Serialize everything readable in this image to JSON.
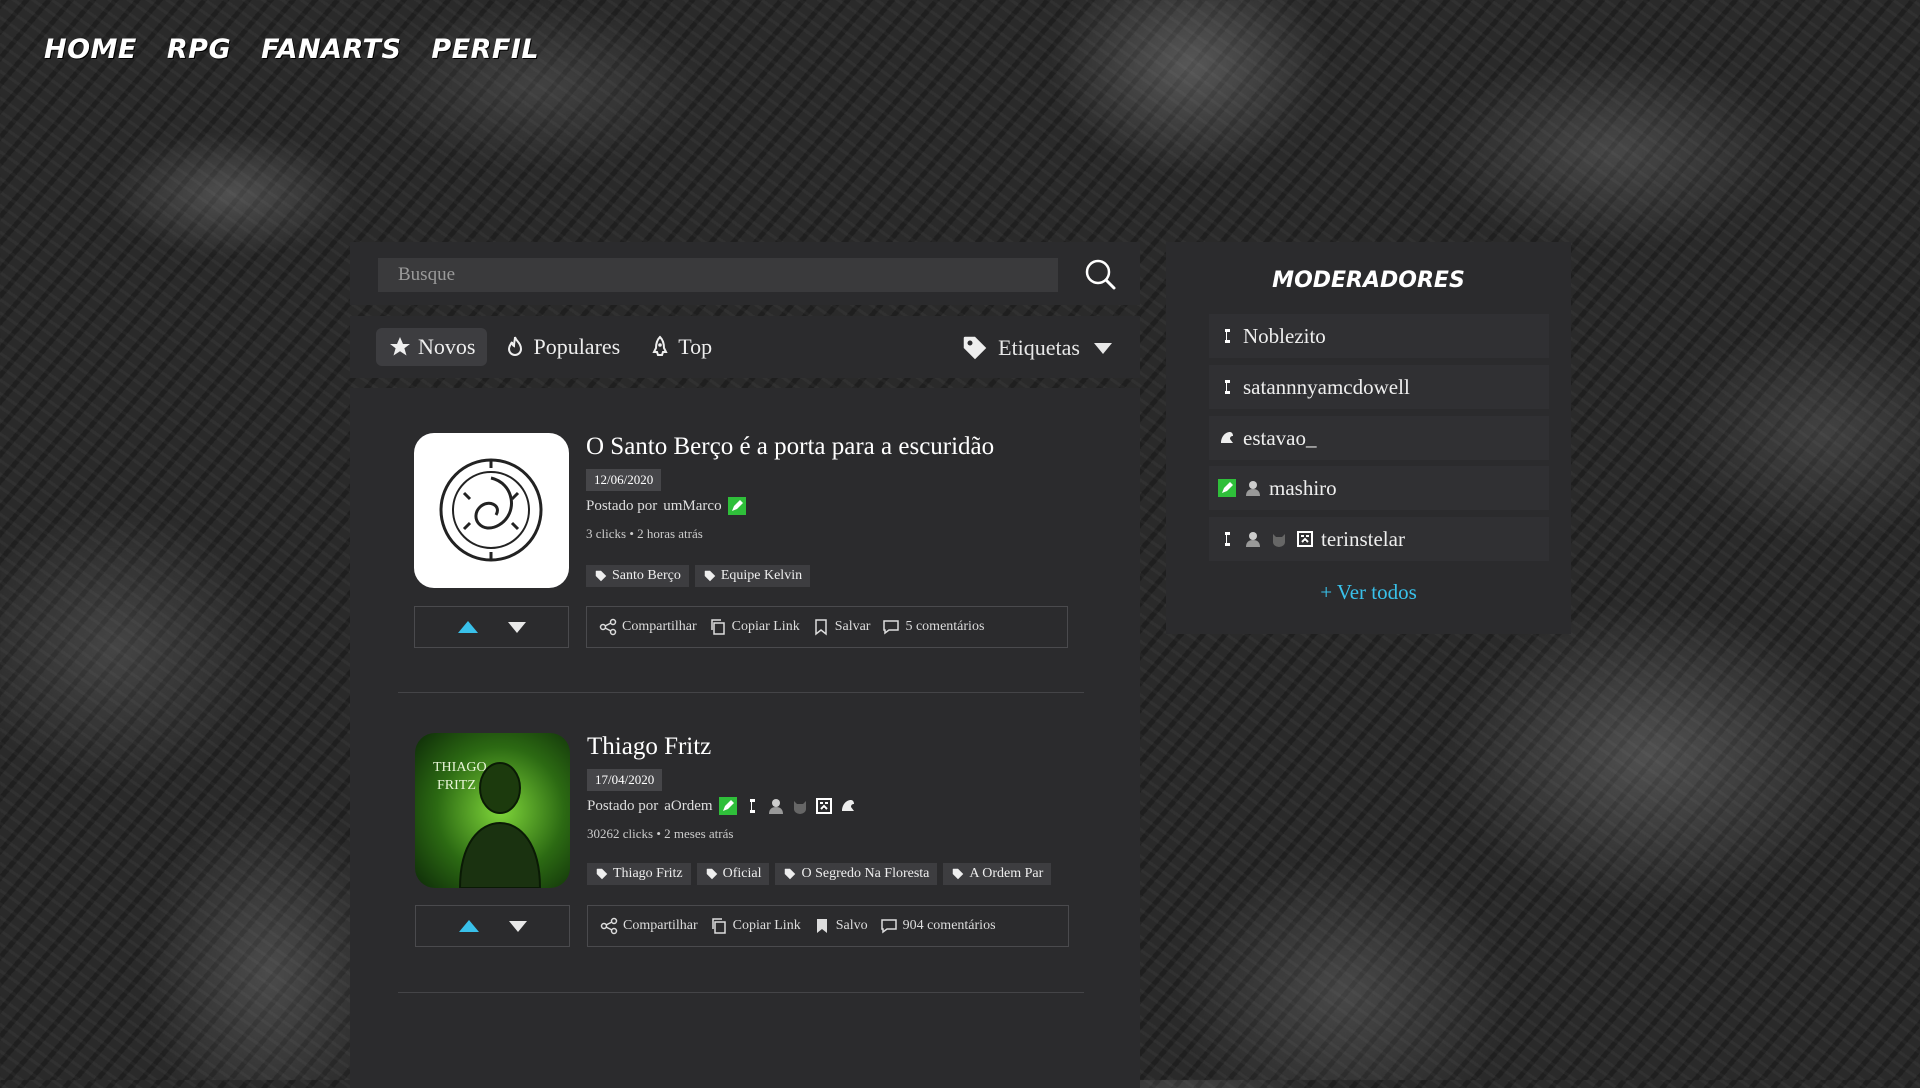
{
  "nav": {
    "items": [
      "HOME",
      "RPG",
      "FANARTS",
      "PERFIL"
    ]
  },
  "search": {
    "placeholder": "Busque"
  },
  "tabs": {
    "items": [
      "Novos",
      "Populares",
      "Top"
    ],
    "active": "Novos",
    "tags_label": "Etiquetas"
  },
  "posts": [
    {
      "title": "O Santo Berço é a porta para a escuridão",
      "date": "12/06/2020",
      "author_prefix": "Postado por",
      "author": "umMarco",
      "stats": "3 clicks • 2 horas atrás",
      "tags": [
        "Santo Berço",
        "Equipe Kelvin"
      ],
      "actions": {
        "share": "Compartilhar",
        "copy": "Copiar Link",
        "save": "Salvar",
        "comments": "5 comentários"
      }
    },
    {
      "title": "Thiago Fritz",
      "date": "17/04/2020",
      "author_prefix": "Postado por",
      "author": "aOrdem",
      "stats": "30262 clicks • 2 meses atrás",
      "tags": [
        "Thiago Fritz",
        "Oficial",
        "O Segredo Na Floresta",
        "A Ordem Par"
      ],
      "thumb_text": "THIAGO FRITZ",
      "actions": {
        "share": "Compartilhar",
        "copy": "Copiar Link",
        "save": "Salvo",
        "comments": "904 comentários"
      }
    }
  ],
  "moderators": {
    "title": "MODERADORES",
    "items": [
      "Noblezito",
      "satannnyamcdowell",
      "estavao_",
      "mashiro",
      "terinstelar"
    ],
    "see_all": "+ Ver todos"
  },
  "colors": {
    "accent": "#39c1ea",
    "badge_green": "#2fbf3a",
    "panel": "#2b2b2d"
  }
}
